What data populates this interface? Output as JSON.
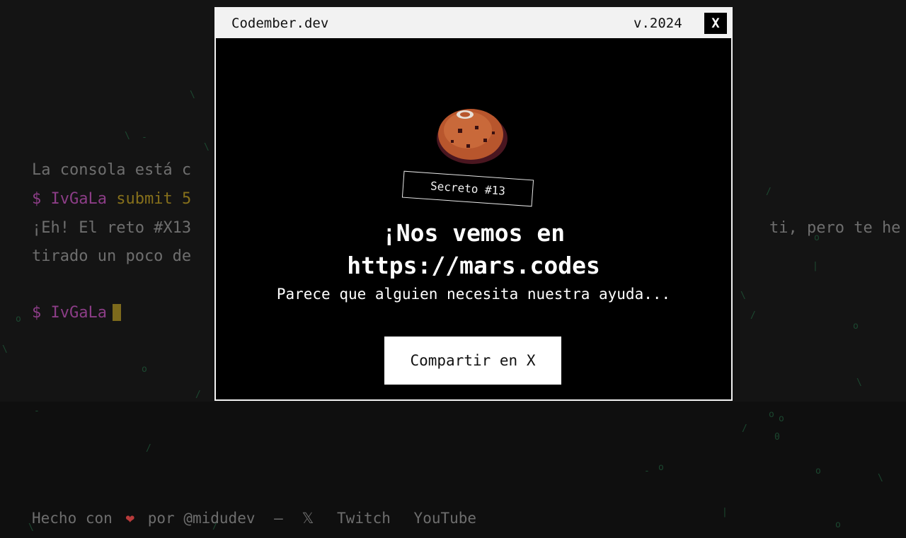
{
  "console": {
    "line1": "La consola está c",
    "line2_prompt": "$",
    "line2_user": "IvGaLa",
    "line2_cmd": "submit",
    "line2_rest": "5",
    "line3_left": "¡Eh! El reto #X13",
    "line3_right": "ti, pero te he",
    "line4": "tirado un poco de",
    "line5_prompt": "$",
    "line5_user": "IvGaLa"
  },
  "modal": {
    "title": "Codember.dev",
    "version": "v.2024",
    "close_label": "X",
    "badge": "Secreto #13",
    "headline_line1": "¡Nos vemos en",
    "headline_line2": "https://mars.codes",
    "subtitle": "Parece que alguien necesita nuestra ayuda...",
    "share_button": "Compartir en X"
  },
  "footer": {
    "made_with": "Hecho con",
    "heart": "❤",
    "by": "por @midudev",
    "dash": "—",
    "x_icon": "𝕏",
    "twitch": "Twitch",
    "youtube": "YouTube"
  },
  "colors": {
    "background": "#141414",
    "prompt": "#8c3d87",
    "command": "#86701b",
    "rain": "#1f5a3a",
    "modal_bg": "#000000",
    "titlebar_bg": "#f2f2f2"
  }
}
